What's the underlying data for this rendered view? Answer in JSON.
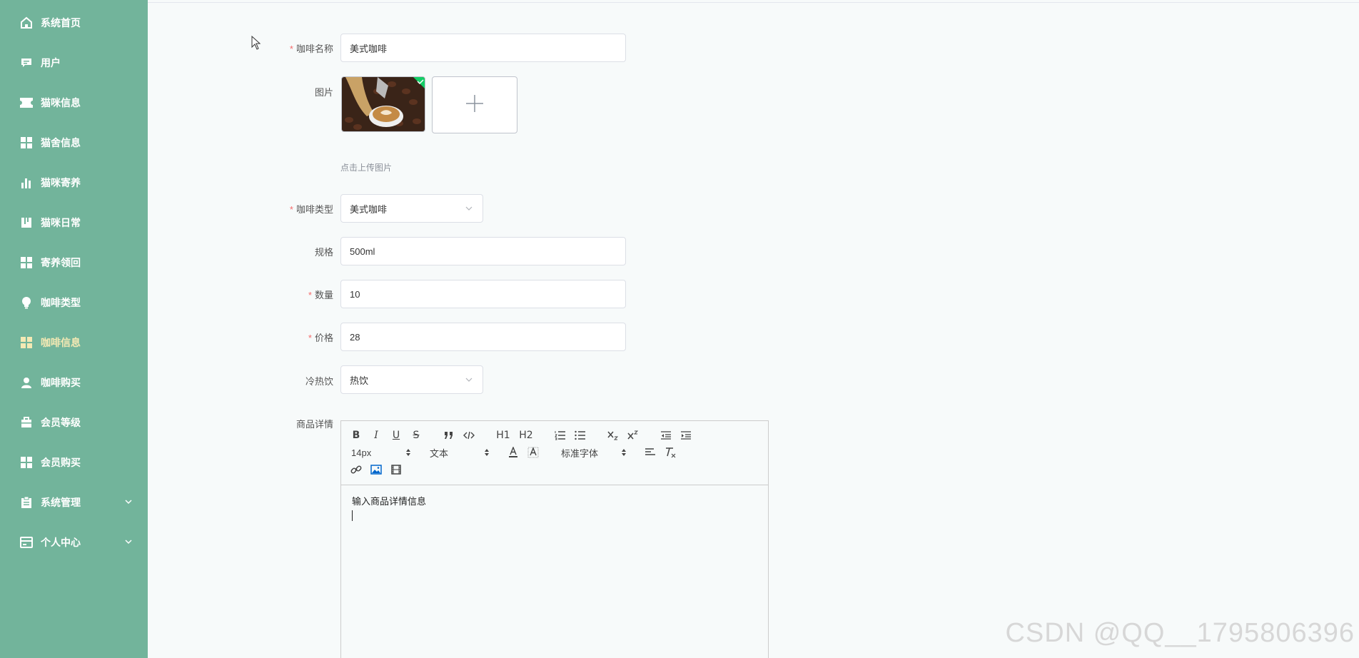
{
  "sidebar": {
    "items": [
      {
        "label": "系统首页",
        "icon": "home-icon"
      },
      {
        "label": "用户",
        "icon": "chat-icon"
      },
      {
        "label": "猫咪信息",
        "icon": "ticket-icon"
      },
      {
        "label": "猫舍信息",
        "icon": "grid-icon"
      },
      {
        "label": "猫咪寄养",
        "icon": "bar-chart-icon"
      },
      {
        "label": "猫咪日常",
        "icon": "book-icon"
      },
      {
        "label": "寄养领回",
        "icon": "grid-icon"
      },
      {
        "label": "咖啡类型",
        "icon": "bulb-icon"
      },
      {
        "label": "咖啡信息",
        "icon": "grid-icon",
        "active": true
      },
      {
        "label": "咖啡购买",
        "icon": "user-icon"
      },
      {
        "label": "会员等级",
        "icon": "briefcase-icon"
      },
      {
        "label": "会员购买",
        "icon": "grid-icon"
      },
      {
        "label": "系统管理",
        "icon": "clipboard-icon",
        "expandable": true
      },
      {
        "label": "个人中心",
        "icon": "card-icon",
        "expandable": true
      }
    ],
    "active_color": "#f4e9b4",
    "background": "#72b49b"
  },
  "form": {
    "name": {
      "label": "咖啡名称",
      "required": "*",
      "value": "美式咖啡"
    },
    "image": {
      "label": "图片",
      "hint": "点击上传图片"
    },
    "type": {
      "label": "咖啡类型",
      "required": "*",
      "value": "美式咖啡"
    },
    "spec": {
      "label": "规格",
      "value": "500ml"
    },
    "qty": {
      "label": "数量",
      "required": "*",
      "value": "10"
    },
    "price": {
      "label": "价格",
      "required": "*",
      "value": "28"
    },
    "temp": {
      "label": "冷热饮",
      "value": "热饮"
    },
    "detail": {
      "label": "商品详情",
      "content": "输入商品详情信息"
    }
  },
  "editor": {
    "font_size": "14px",
    "block_format": "文本",
    "font_family": "标准字体",
    "bold": "B",
    "italic": "I",
    "underline": "U",
    "strike": "S",
    "h1": "H1",
    "h2": "H2"
  },
  "watermark": "CSDN @QQ__1795806396"
}
